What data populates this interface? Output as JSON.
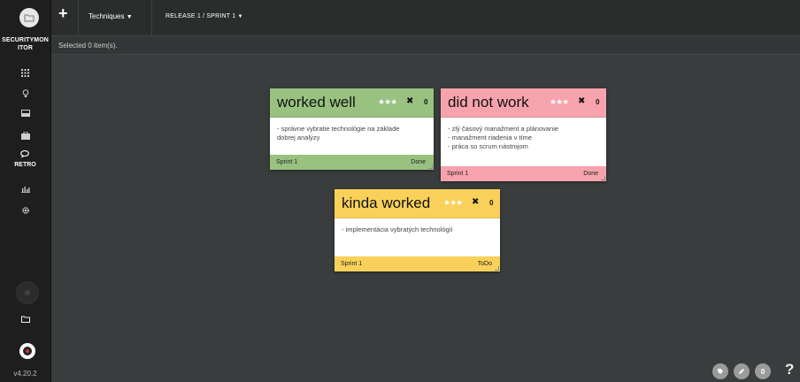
{
  "app": {
    "name_line1": "SECURITYMON",
    "name_line2": "ITOR",
    "version": "v4.20.2"
  },
  "sidebar": {
    "items": [
      {
        "icon": "grid-icon",
        "label": ""
      },
      {
        "icon": "lightbulb-icon",
        "label": ""
      },
      {
        "icon": "inbox-icon",
        "label": ""
      },
      {
        "icon": "briefcase-icon",
        "label": ""
      },
      {
        "icon": "retro-icon",
        "label": "RETRO"
      },
      {
        "icon": "bar-chart-icon",
        "label": ""
      },
      {
        "icon": "gear-icon",
        "label": ""
      }
    ]
  },
  "toolbar": {
    "add_label": "+",
    "techniques_label": "Techniques",
    "release_label": "RELEASE 1 / SPRINT 1"
  },
  "selection": {
    "text": "Selected 0 item(s)."
  },
  "cards": [
    {
      "title": "worked well",
      "votes": "0",
      "lines": [
        "- správne vybratie technológie na základe",
        "dobrej analýzy"
      ],
      "sprint": "Sprint 1",
      "status": "Done",
      "color": "#99c281"
    },
    {
      "title": "did not work",
      "votes": "0",
      "lines": [
        "- zlý časový manažment a plánovanie",
        "- manažment riadenia v tíme",
        "- práca so scrum nástrojom"
      ],
      "sprint": "Sprint 1",
      "status": "Done",
      "color": "#f7a3ad"
    },
    {
      "title": "kinda worked",
      "votes": "0",
      "lines": [
        "- implementácia vybratých technológií"
      ],
      "sprint": "Sprint 1",
      "status": "ToDo",
      "color": "#f9d15a"
    }
  ],
  "fab": {
    "count": "0",
    "help": "?"
  }
}
